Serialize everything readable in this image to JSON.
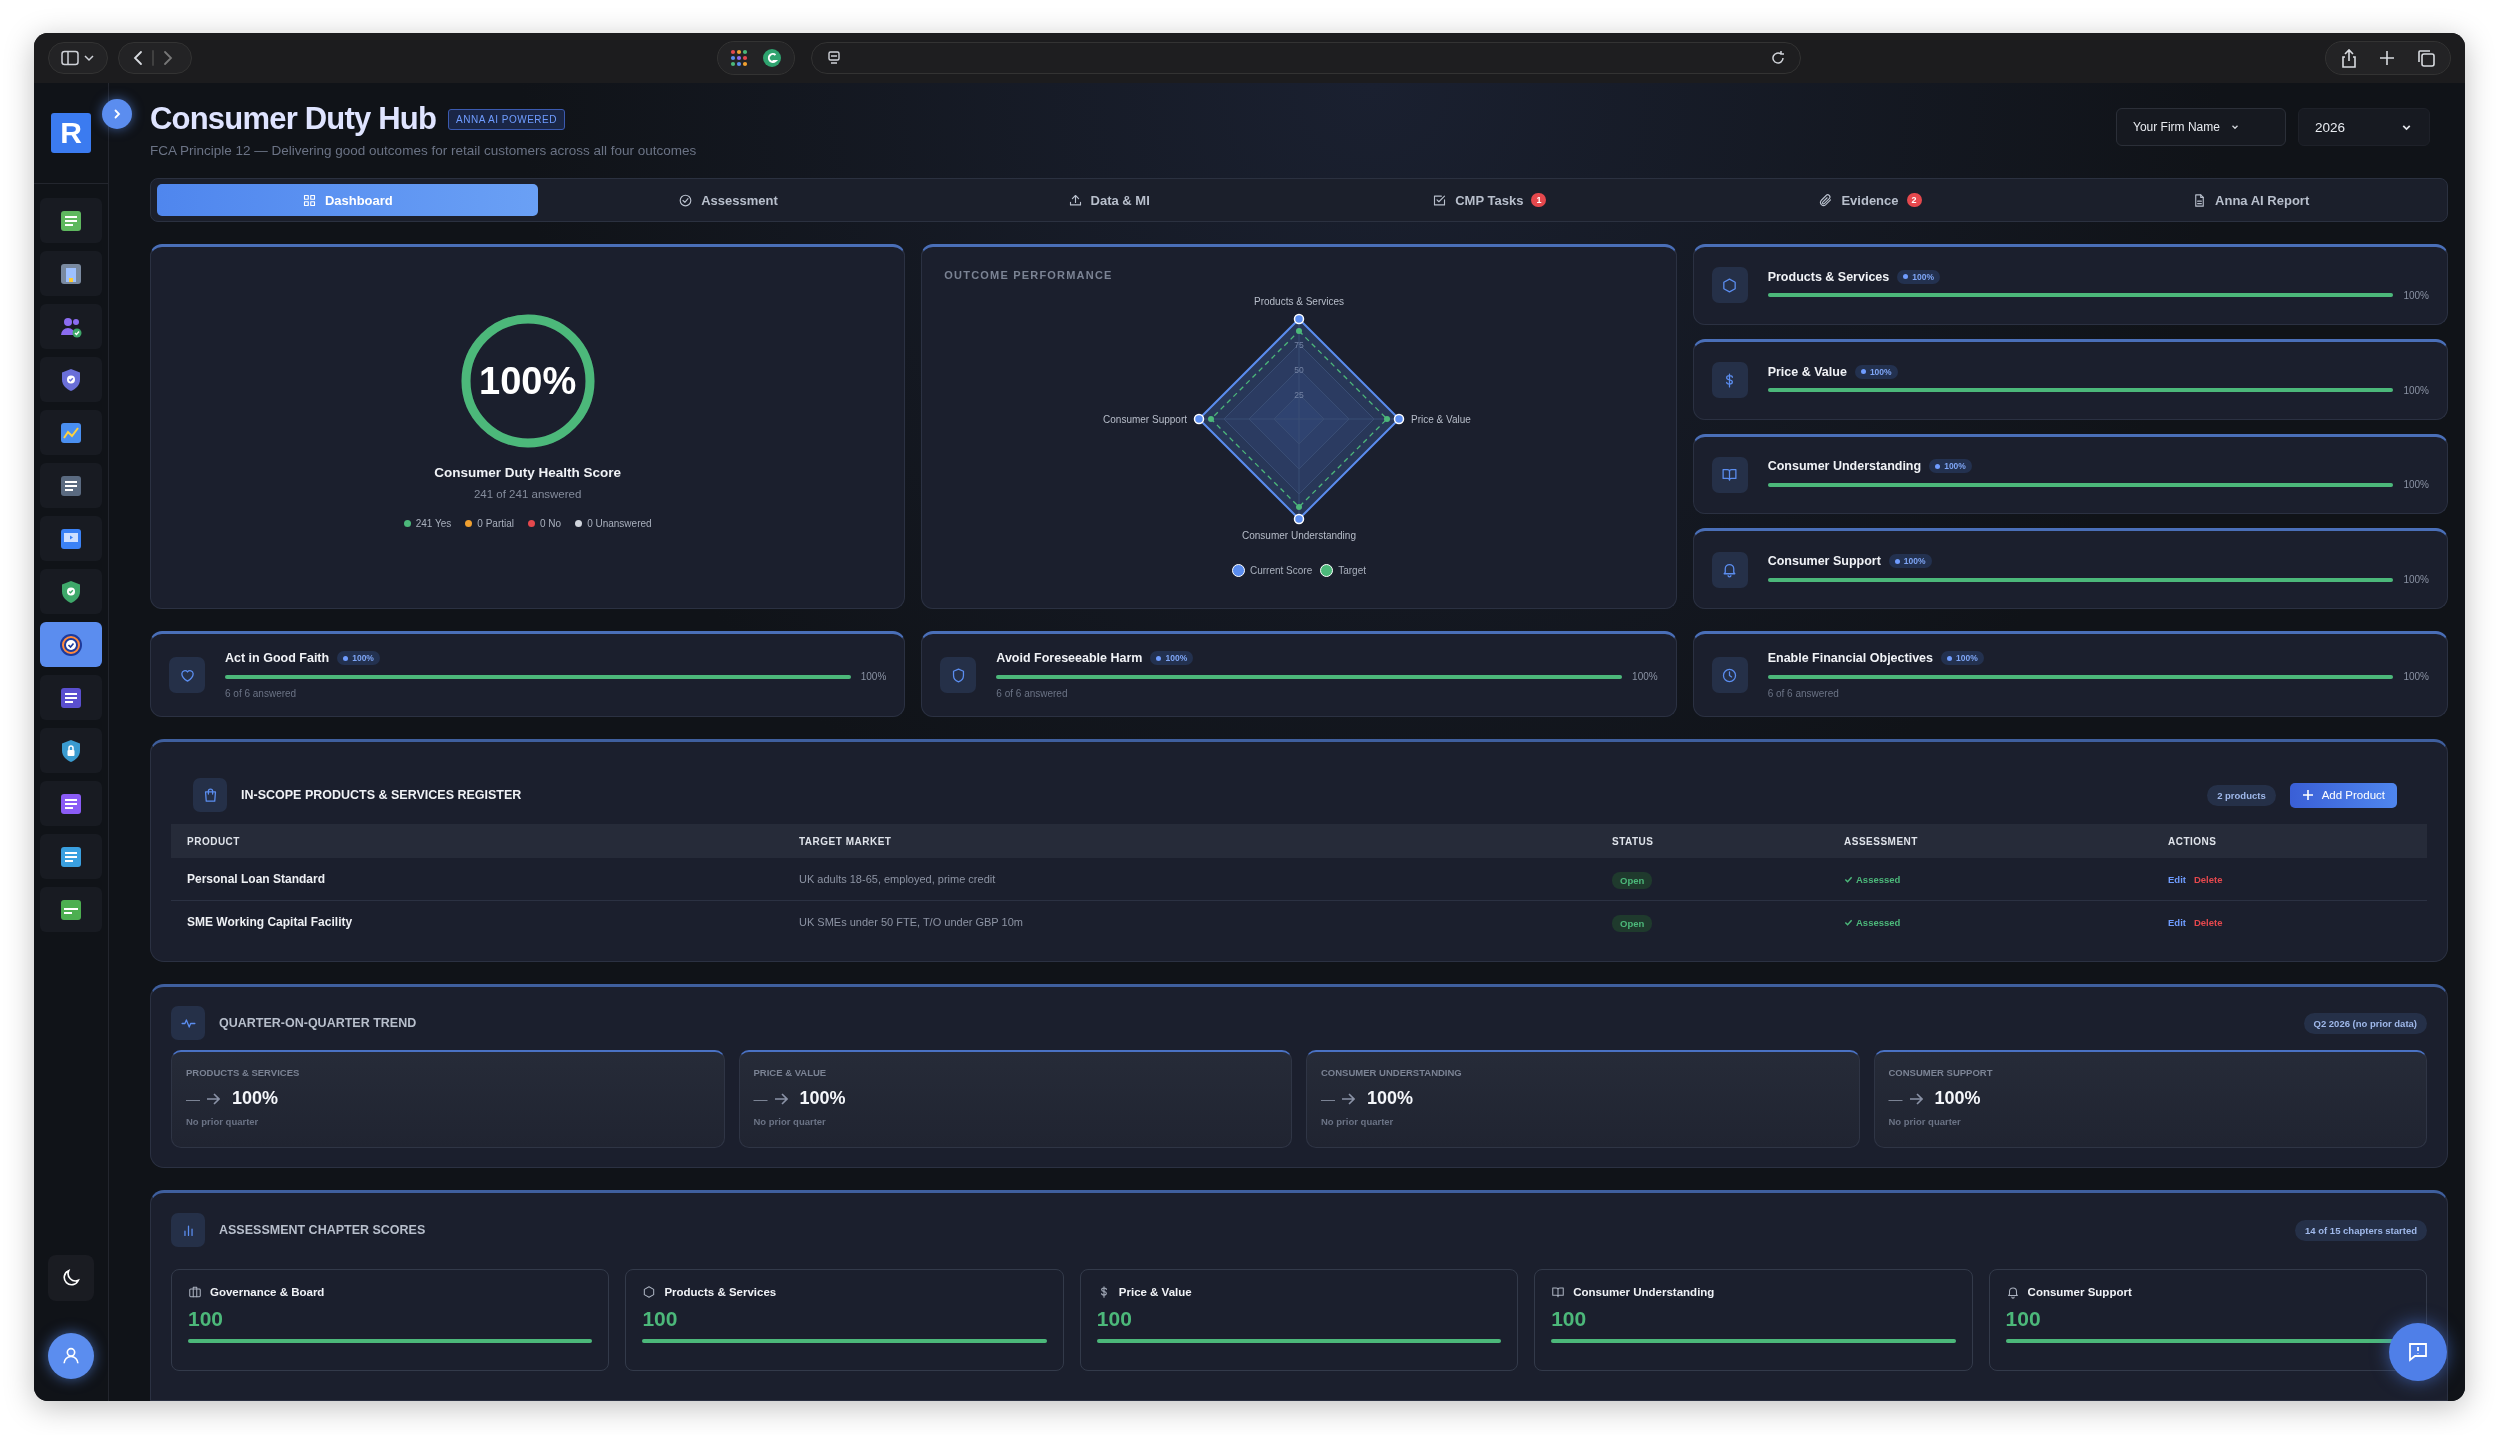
{
  "sidebar": {
    "logo": "R",
    "items": [
      {
        "selected": false
      },
      {
        "selected": false
      },
      {
        "selected": false
      },
      {
        "selected": false
      },
      {
        "selected": false
      },
      {
        "selected": false
      },
      {
        "selected": false
      },
      {
        "selected": false
      },
      {
        "selected": true
      },
      {
        "selected": false
      },
      {
        "selected": false
      },
      {
        "selected": false
      },
      {
        "selected": false
      },
      {
        "selected": false
      }
    ]
  },
  "header": {
    "title": "Consumer Duty Hub",
    "badge": "ANNA AI POWERED",
    "subtitle": "FCA Principle 12 — Delivering good outcomes for retail customers across all four outcomes",
    "firm_select": {
      "value": "Your Firm Name"
    },
    "year_select": {
      "value": "2026"
    }
  },
  "tabs": [
    {
      "label": "Dashboard",
      "selected": true
    },
    {
      "label": "Assessment",
      "selected": false
    },
    {
      "label": "Data & MI",
      "selected": false
    },
    {
      "label": "CMP Tasks",
      "badge": "1",
      "selected": false
    },
    {
      "label": "Evidence",
      "badge": "2",
      "selected": false
    },
    {
      "label": "Anna AI Report",
      "selected": false
    }
  ],
  "health": {
    "score": "100%",
    "level": 1,
    "title": "Consumer Duty Health Score",
    "answered": "241 of 241 answered",
    "legend": [
      {
        "label": "241 Yes",
        "color": "#4cb87a"
      },
      {
        "label": "0 Partial",
        "color": "#f0a030"
      },
      {
        "label": "0 No",
        "color": "#e5484d"
      },
      {
        "label": "0 Unanswered",
        "color": "#d0d4dc"
      }
    ]
  },
  "outcome_performance": {
    "title": "OUTCOME PERFORMANCE",
    "axes": [
      "Products & Services",
      "Price & Value",
      "Consumer Understanding",
      "Consumer Support"
    ],
    "ticks": [
      "75",
      "50",
      "25"
    ],
    "legend": [
      {
        "label": "Current Score",
        "color": "#5b8def"
      },
      {
        "label": "Target",
        "color": "#4cb87a"
      }
    ]
  },
  "outcomes": [
    {
      "name": "Products & Services",
      "badge": "100%",
      "level": 1,
      "reading": "100%"
    },
    {
      "name": "Price & Value",
      "badge": "100%",
      "level": 1,
      "reading": "100%"
    },
    {
      "name": "Consumer Understanding",
      "badge": "100%",
      "level": 1,
      "reading": "100%"
    },
    {
      "name": "Consumer Support",
      "badge": "100%",
      "level": 1,
      "reading": "100%"
    }
  ],
  "principles": [
    {
      "name": "Act in Good Faith",
      "badge": "100%",
      "level": 1,
      "reading": "100%",
      "answered": "6 of 6 answered"
    },
    {
      "name": "Avoid Foreseeable Harm",
      "badge": "100%",
      "level": 1,
      "reading": "100%",
      "answered": "6 of 6 answered"
    },
    {
      "name": "Enable Financial Objectives",
      "badge": "100%",
      "level": 1,
      "reading": "100%",
      "answered": "6 of 6 answered"
    }
  ],
  "register": {
    "title": "IN-SCOPE PRODUCTS & SERVICES REGISTER",
    "count": "2 products",
    "add_button": "Add Product",
    "columns": [
      "PRODUCT",
      "TARGET MARKET",
      "STATUS",
      "ASSESSMENT",
      "ACTIONS"
    ],
    "rows": [
      {
        "product": "Personal Loan Standard",
        "target_market": "UK adults 18-65, employed, prime credit",
        "status": "Open",
        "assessment": "Assessed",
        "actions": [
          "Edit",
          "Delete"
        ]
      },
      {
        "product": "SME Working Capital Facility",
        "target_market": "UK SMEs under 50 FTE, T/O under GBP 10m",
        "status": "Open",
        "assessment": "Assessed",
        "actions": [
          "Edit",
          "Delete"
        ]
      }
    ]
  },
  "trend": {
    "title": "QUARTER-ON-QUARTER TREND",
    "badge": "Q2 2026 (no prior data)",
    "cards": [
      {
        "label": "PRODUCTS & SERVICES",
        "prior": "—",
        "value": "100%",
        "note": "No prior quarter"
      },
      {
        "label": "PRICE & VALUE",
        "prior": "—",
        "value": "100%",
        "note": "No prior quarter"
      },
      {
        "label": "CONSUMER UNDERSTANDING",
        "prior": "—",
        "value": "100%",
        "note": "No prior quarter"
      },
      {
        "label": "CONSUMER SUPPORT",
        "prior": "—",
        "value": "100%",
        "note": "No prior quarter"
      }
    ]
  },
  "chapters": {
    "title": "ASSESSMENT CHAPTER SCORES",
    "badge": "14 of 15 chapters started",
    "cards": [
      {
        "name": "Governance & Board",
        "score": "100",
        "level": 1
      },
      {
        "name": "Products & Services",
        "score": "100",
        "level": 1
      },
      {
        "name": "Price & Value",
        "score": "100",
        "level": 1
      },
      {
        "name": "Consumer Understanding",
        "score": "100",
        "level": 1
      },
      {
        "name": "Consumer Support",
        "score": "100",
        "level": 1
      }
    ]
  }
}
